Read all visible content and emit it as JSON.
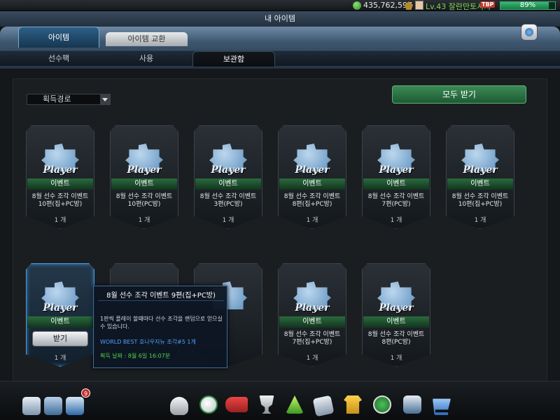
{
  "status": {
    "money": "435,762,597",
    "username": "Lv.43 잘란만토사차",
    "tbp": "TBP",
    "battery": "89%",
    "battery_level": 0.89
  },
  "window": {
    "title": "내 아이템"
  },
  "main_tabs": [
    {
      "label": "아이템"
    },
    {
      "label": "아이템 교환"
    }
  ],
  "sub_tabs": [
    {
      "label": "선수팩"
    },
    {
      "label": "사용"
    },
    {
      "label": "보관함"
    }
  ],
  "filter": {
    "selected": "획득경로"
  },
  "receive_all": "모두 받기",
  "cards": [
    {
      "type": "Player",
      "band": "이벤트",
      "name_line1": "8월 선수 조각 이벤트",
      "name_line2": "10편(집+PC방)",
      "qty": "1 개"
    },
    {
      "type": "Player",
      "band": "이벤트",
      "name_line1": "8월 선수 조각 이벤트",
      "name_line2": "10편(PC방)",
      "qty": "1 개"
    },
    {
      "type": "Player",
      "band": "이벤트",
      "name_line1": "8월 선수 조각 이벤트",
      "name_line2": "3편(PC방)",
      "qty": "1 개"
    },
    {
      "type": "Player",
      "band": "이벤트",
      "name_line1": "8월 선수 조각 이벤트",
      "name_line2": "8편(집+PC방)",
      "qty": "1 개"
    },
    {
      "type": "Player",
      "band": "이벤트",
      "name_line1": "8월 선수 조각 이벤트",
      "name_line2": "7편(PC방)",
      "qty": "1 개"
    },
    {
      "type": "Player",
      "band": "이벤트",
      "name_line1": "8월 선수 조각 이벤트",
      "name_line2": "10편(집+PC방)",
      "qty": "1 개"
    },
    {
      "type": "Player",
      "band": "이벤트",
      "button": "받기",
      "qty": "1 개"
    },
    {
      "type": "Player",
      "band": "이벤트",
      "name_line1": "8월 선수 조각 이벤트",
      "name_line2": "7편(집+PC방)",
      "qty": "1 개"
    },
    {
      "type": "Player",
      "band": "이벤트",
      "name_line1": "8월 선수 조각 이벤트",
      "name_line2": "8편(PC방)",
      "qty": "1 개"
    }
  ],
  "tooltip": {
    "title": "8월 선수 조각 이벤트 9편(집+PC방)",
    "desc": "1판씩 플레이 할때마다 선수 조각을 랜덤으로 얻으실 수 있습니다.",
    "link": "WORLD BEST 호나우지뉴 조각#5 1개",
    "date": "획득 날짜 : 8월 6일 16:07분"
  },
  "mail_badge": "9",
  "bottom_icons": [
    "mascot-icon",
    "notice-icon",
    "mail-icon",
    "whistle-icon",
    "ball-icon",
    "boots-icon",
    "trophy-icon",
    "formation-icon",
    "tactics-icon",
    "jersey-icon",
    "club-icon",
    "card-icon",
    "shop-cart-icon"
  ]
}
